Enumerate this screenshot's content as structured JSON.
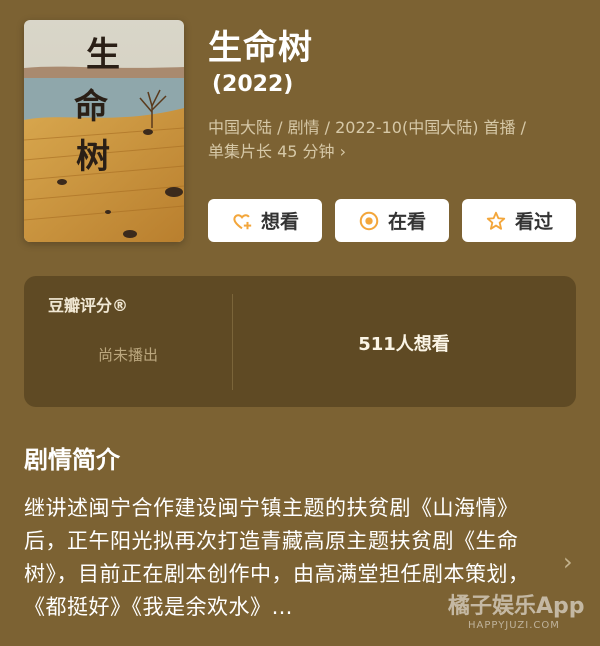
{
  "poster": {
    "title_art": "生命树",
    "icon": "poster-image"
  },
  "header": {
    "title": "生命树",
    "year": "(2022)",
    "meta_line1": "中国大陆 / 剧情 / 2022-10(中国大陆) 首播 /",
    "meta_line2": "单集片长 45 分钟",
    "meta_chevron": "›"
  },
  "actions": [
    {
      "label": "想看",
      "icon": "heart-plus-icon",
      "color": "#f3a63b"
    },
    {
      "label": "在看",
      "icon": "record-icon",
      "color": "#f3a63b"
    },
    {
      "label": "看过",
      "icon": "star-icon",
      "color": "#f3a63b"
    }
  ],
  "rating": {
    "label": "豆瓣评分®",
    "empty_text": "尚未播出",
    "want_count": "511人想看"
  },
  "synopsis": {
    "title": "剧情简介",
    "text": "继讲述闽宁合作建设闽宁镇主题的扶贫剧《山海情》后，正午阳光拟再次打造青藏高原主题扶贫剧《生命树》，目前正在剧本创作中，由高满堂担任剧本策划，《都挺好》《我是余欢水》…",
    "chevron": "›"
  },
  "watermark": {
    "brand": "橘子娱乐App",
    "site": "HAPPYJUZI.COM"
  }
}
